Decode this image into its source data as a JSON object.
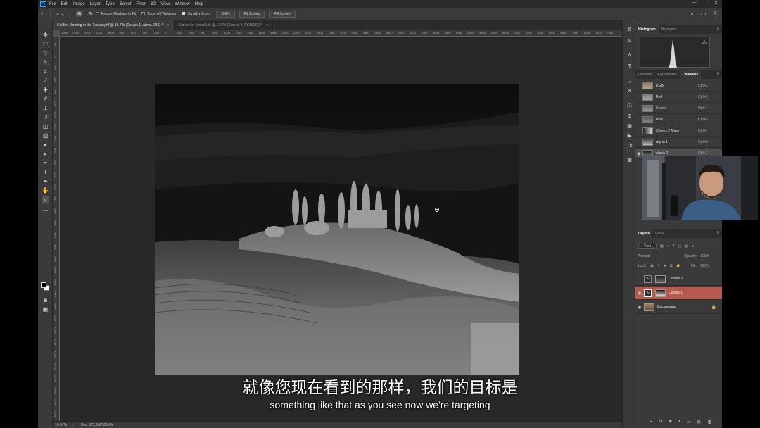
{
  "menubar": {
    "app_icon": "Ps",
    "items": [
      "File",
      "Edit",
      "Image",
      "Layer",
      "Type",
      "Select",
      "Filter",
      "3D",
      "View",
      "Window",
      "Help"
    ],
    "window_controls": [
      "—",
      "❐",
      "✕"
    ]
  },
  "options": {
    "resize_windows": "Resize Windows to Fit",
    "zoom_all": "Zoom All Windows",
    "scrubby_zoom": "Scrubby Zoom",
    "zoom_value": "100%",
    "fit_screen": "Fit Screen",
    "fill_screen": "Fill Screen",
    "resize_checked": false,
    "zoom_all_checked": false,
    "scrubby_checked": true
  },
  "tabs": [
    {
      "label": "Golden Morning in the Tuscany.tif @ 16.7% (Curves 1, Alpha 2/16) *",
      "close": "×"
    },
    {
      "label": "Sunrise in Janosik.tif @ 17.2% (Curves 3, RGB/16*) *",
      "close": "×"
    }
  ],
  "ruler_top": [
    "1800",
    "1600",
    "1400",
    "1200",
    "1000",
    "800",
    "600",
    "400",
    "200",
    "0",
    "200",
    "400",
    "600",
    "800",
    "1000",
    "1200",
    "1400",
    "1600",
    "1800",
    "2000",
    "2200",
    "2400",
    "2600",
    "2800",
    "3000",
    "3200",
    "3400",
    "3600",
    "3800",
    "4000",
    "4200",
    "4400",
    "4600",
    "4800",
    "5000",
    "5200",
    "5400",
    "5600",
    "5800",
    "6000",
    "6200",
    "6400",
    "6600",
    "6800",
    "7000",
    "7200",
    "7400",
    "7600"
  ],
  "ruler_left": [
    "200",
    "0",
    "200",
    "400",
    "600",
    "800",
    "1000",
    "1200",
    "1400",
    "1600",
    "1800",
    "2000",
    "2200",
    "2400",
    "2600",
    "2800",
    "3000",
    "3200",
    "3400",
    "3600",
    "3800",
    "4000",
    "4200",
    "4400",
    "4600",
    "4800",
    "5000",
    "5200",
    "5400",
    "5600",
    "5800",
    "6000"
  ],
  "status": {
    "zoom": "16.67%",
    "doc": "Doc: 172,6M/336,0M"
  },
  "top_panel": {
    "tabs": [
      "Histogram",
      "Navigator"
    ],
    "menu": "≡",
    "warning": "⚠"
  },
  "channels_panel": {
    "tabs": [
      "Libraries",
      "Adjustments",
      "Channels"
    ],
    "rows": [
      {
        "name": "RGB",
        "shortcut": "Ctrl+2"
      },
      {
        "name": "Red",
        "shortcut": "Ctrl+3"
      },
      {
        "name": "Green",
        "shortcut": "Ctrl+4"
      },
      {
        "name": "Blue",
        "shortcut": "Ctrl+5"
      },
      {
        "name": "Curves 2 Mask",
        "shortcut": "Ctrl+\\"
      },
      {
        "name": "Alpha 1",
        "shortcut": "Ctrl+6"
      },
      {
        "name": "Alpha 2",
        "shortcut": "Ctrl+7"
      }
    ]
  },
  "layers_panel": {
    "tabs": [
      "Layers",
      "Paths"
    ],
    "kind": "Kind",
    "blend": "Normal",
    "opacity_label": "Opacity:",
    "opacity_value": "100%",
    "lock_label": "Lock:",
    "fill_label": "Fill:",
    "fill_value": "100%",
    "layers": [
      {
        "name": "Curves 2"
      },
      {
        "name": "Curves 1"
      },
      {
        "name": "Background"
      }
    ]
  },
  "subtitles": {
    "cn": "就像您现在看到的那样，我们的目标是",
    "en": "something like that as you see now we're targeting"
  },
  "colors": {
    "selected_layer": "#b45a4e",
    "panel_bg": "#3a3a3a",
    "canvas_bg": "#282828"
  }
}
